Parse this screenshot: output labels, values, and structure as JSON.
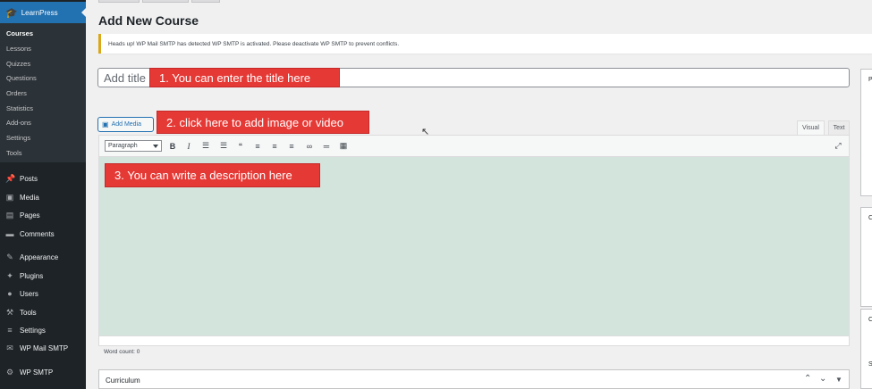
{
  "sidebar": {
    "plugin_label": "LearnPress",
    "submenu": [
      "Courses",
      "Lessons",
      "Quizzes",
      "Questions",
      "Orders",
      "Statistics",
      "Add-ons",
      "Settings",
      "Tools"
    ],
    "menu": [
      {
        "label": "Posts",
        "icon": "pin-icon"
      },
      {
        "label": "Media",
        "icon": "media-icon"
      },
      {
        "label": "Pages",
        "icon": "pages-icon"
      },
      {
        "label": "Comments",
        "icon": "comment-icon"
      },
      {
        "label": "Appearance",
        "icon": "brush-icon"
      },
      {
        "label": "Plugins",
        "icon": "plug-icon"
      },
      {
        "label": "Users",
        "icon": "user-icon"
      },
      {
        "label": "Tools",
        "icon": "wrench-icon"
      },
      {
        "label": "Settings",
        "icon": "sliders-icon"
      },
      {
        "label": "WP Mail SMTP",
        "icon": "mail-icon"
      },
      {
        "label": "WP SMTP",
        "icon": "gear-icon"
      }
    ]
  },
  "page": {
    "title": "Add New Course",
    "notice": "Heads up! WP Mail SMTP has detected WP SMTP is activated. Please deactivate WP SMTP to prevent conflicts.",
    "title_placeholder": "Add title"
  },
  "callouts": {
    "title": "1. You can enter the title here",
    "media": "2. click here to add image or video",
    "description": "3. You can write a description here"
  },
  "editor": {
    "add_media_label": "Add Media",
    "tab_visual": "Visual",
    "tab_text": "Text",
    "format_select": "Paragraph",
    "word_count": "Word count: 0"
  },
  "curriculum": {
    "title": "Curriculum"
  },
  "right_panel": {
    "letters": [
      "P",
      "C",
      "C",
      "S"
    ]
  },
  "colors": {
    "sidebar_bg": "#1d2327",
    "accent": "#2271b1",
    "callout": "#e53935",
    "editor_bg": "#d3e4dd",
    "notice_border": "#dba617"
  }
}
